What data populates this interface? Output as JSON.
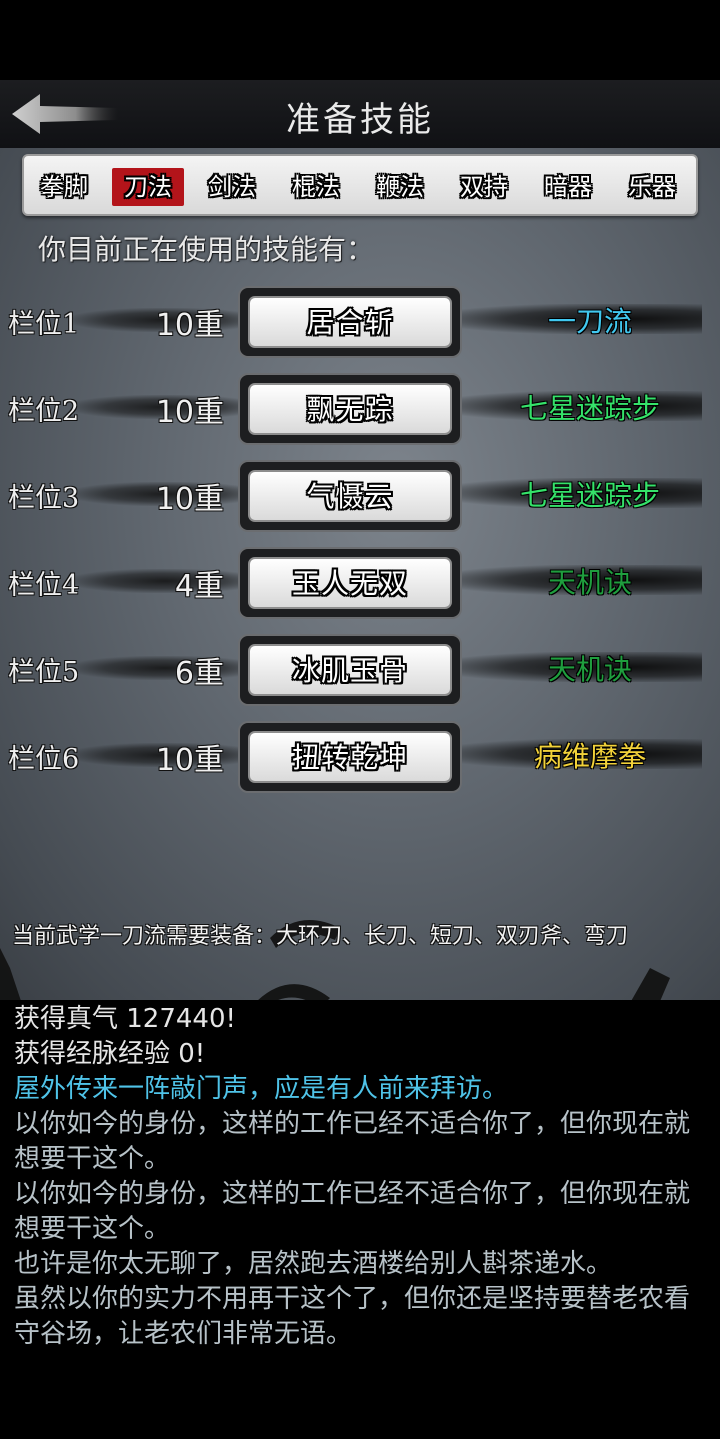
{
  "header": {
    "title": "准备技能"
  },
  "tabs": [
    {
      "label": "拳脚",
      "active": false
    },
    {
      "label": "刀法",
      "active": true
    },
    {
      "label": "剑法",
      "active": false
    },
    {
      "label": "棍法",
      "active": false
    },
    {
      "label": "鞭法",
      "active": false
    },
    {
      "label": "双持",
      "active": false
    },
    {
      "label": "暗器",
      "active": false
    },
    {
      "label": "乐器",
      "active": false
    }
  ],
  "using_label": "你目前正在使用的技能有：",
  "slots": [
    {
      "label": "栏位1",
      "level": "10重",
      "skill": "居合斩",
      "martial": "一刀流",
      "color": "#41c8f0"
    },
    {
      "label": "栏位2",
      "level": "10重",
      "skill": "飘无踪",
      "martial": "七星迷踪步",
      "color": "#35e26a"
    },
    {
      "label": "栏位3",
      "level": "10重",
      "skill": "气慑云",
      "martial": "七星迷踪步",
      "color": "#35e26a"
    },
    {
      "label": "栏位4",
      "level": "4重",
      "skill": "玉人无双",
      "martial": "天机诀",
      "color": "#1f9e3e"
    },
    {
      "label": "栏位5",
      "level": "6重",
      "skill": "冰肌玉骨",
      "martial": "天机诀",
      "color": "#1f9e3e"
    },
    {
      "label": "栏位6",
      "level": "10重",
      "skill": "扭转乾坤",
      "martial": "病维摩拳",
      "color": "#f2d23a"
    }
  ],
  "equip_text": "当前武学一刀流需要装备：大环刀、长刀、短刀、双刃斧、弯刀",
  "log": [
    {
      "text": "获得真气 127440!",
      "color": "#e6e6e6"
    },
    {
      "text": "获得经脉经验 0!",
      "color": "#e6e6e6"
    },
    {
      "text": "屋外传来一阵敲门声，应是有人前来拜访。",
      "color": "#4fc3e8"
    },
    {
      "text": "以你如今的身份，这样的工作已经不适合你了，但你现在就想要干这个。",
      "color": "#b7c2c8"
    },
    {
      "text": "以你如今的身份，这样的工作已经不适合你了，但你现在就想要干这个。",
      "color": "#b7c2c8"
    },
    {
      "text": "也许是你太无聊了，居然跑去酒楼给别人斟茶递水。",
      "color": "#b7c2c8"
    },
    {
      "text": "虽然以你的实力不用再干这个了，但你还是坚持要替老农看守谷场，让老农们非常无语。",
      "color": "#b7c2c8"
    }
  ],
  "icons": {
    "back": "back-arrow-icon"
  }
}
